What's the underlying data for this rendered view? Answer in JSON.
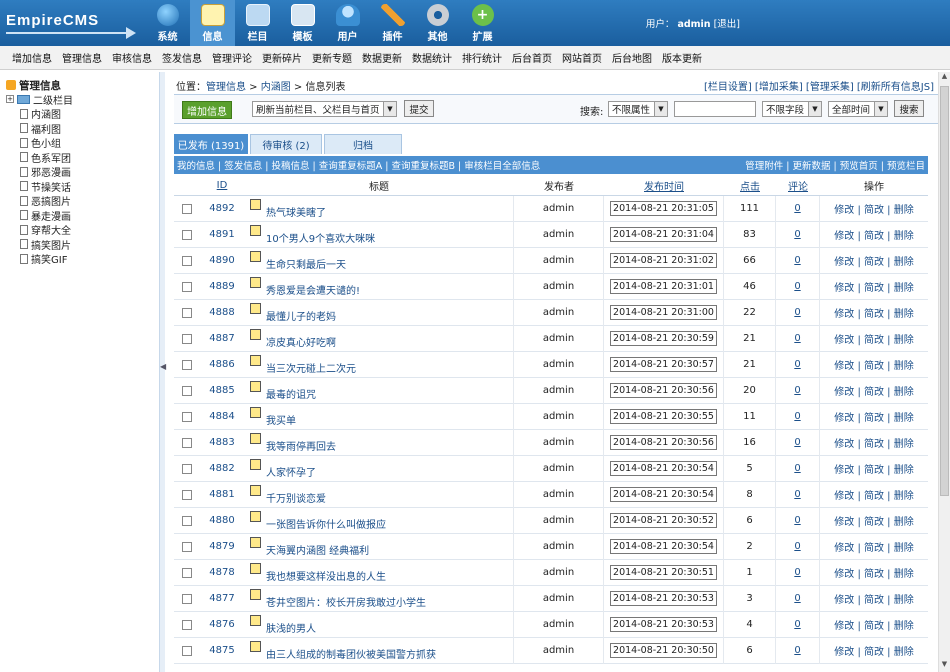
{
  "logo": "EmpireCMS",
  "topnav": [
    {
      "label": "系统",
      "icon": "globe-icon"
    },
    {
      "label": "信息",
      "icon": "document-edit-icon"
    },
    {
      "label": "栏目",
      "icon": "folder-icon"
    },
    {
      "label": "模板",
      "icon": "template-icon"
    },
    {
      "label": "用户",
      "icon": "user-icon"
    },
    {
      "label": "插件",
      "icon": "tools-icon"
    },
    {
      "label": "其他",
      "icon": "gear-icon"
    },
    {
      "label": "扩展",
      "icon": "plus-circle-icon"
    }
  ],
  "user": {
    "prefix": "用户：",
    "name": "admin",
    "logout": "[退出]"
  },
  "submenu": [
    "增加信息",
    "管理信息",
    "审核信息",
    "签发信息",
    "管理评论",
    "更新碎片",
    "更新专题",
    "数据更新",
    "数据统计",
    "排行统计",
    "后台首页",
    "网站首页",
    "后台地图",
    "版本更新"
  ],
  "sidebar": {
    "title": "管理信息",
    "parent": "二级栏目",
    "items": [
      "内涵图",
      "福利图",
      "色小组",
      "色系军团",
      "邪恶漫画",
      "节操笑话",
      "恶搞图片",
      "暴走漫画",
      "穿帮大全",
      "搞笑图片",
      "搞笑GIF"
    ]
  },
  "breadcrumb": {
    "prefix": "位置：",
    "l1": "管理信息",
    "sep": " > ",
    "l2": "内涵图",
    "l3": "信息列表"
  },
  "toplinks": "[栏目设置] [增加采集] [管理采集] [刷新所有信息JS]",
  "toolbar": {
    "add": "增加信息",
    "refresh_select": "刷新当前栏目、父栏目与首页",
    "submit": "提交",
    "search_label": "搜索:",
    "attr_select": "不限属性",
    "field_select": "不限字段",
    "time_select": "全部时间",
    "search_btn": "搜索"
  },
  "tabs": [
    "已发布 (1391)",
    "待审核 (2)",
    "归档"
  ],
  "bar": {
    "left": "我的信息 | 签发信息 | 投稿信息 | 查询重复标题A | 查询重复标题B | 审核栏目全部信息",
    "right": "管理附件 | 更新数据 | 预览首页 | 预览栏目"
  },
  "columns": {
    "id": "ID",
    "title": "标题",
    "publisher": "发布者",
    "time": "发布时间",
    "clicks": "点击",
    "comments": "评论",
    "ops": "操作"
  },
  "rows": [
    {
      "id": "4892",
      "title": "热气球美瞎了",
      "pub": "admin",
      "time": "2014-08-21 20:31:05",
      "clicks": "111",
      "cmt": "0"
    },
    {
      "id": "4891",
      "title": "10个男人9个喜欢大咪咪",
      "pub": "admin",
      "time": "2014-08-21 20:31:04",
      "clicks": "83",
      "cmt": "0"
    },
    {
      "id": "4890",
      "title": "生命只剩最后一天",
      "pub": "admin",
      "time": "2014-08-21 20:31:02",
      "clicks": "66",
      "cmt": "0"
    },
    {
      "id": "4889",
      "title": "秀恩爱是会遭天谴的!",
      "pub": "admin",
      "time": "2014-08-21 20:31:01",
      "clicks": "46",
      "cmt": "0"
    },
    {
      "id": "4888",
      "title": "最懂儿子的老妈",
      "pub": "admin",
      "time": "2014-08-21 20:31:00",
      "clicks": "22",
      "cmt": "0"
    },
    {
      "id": "4887",
      "title": "凉皮真心好吃啊",
      "pub": "admin",
      "time": "2014-08-21 20:30:59",
      "clicks": "21",
      "cmt": "0"
    },
    {
      "id": "4886",
      "title": "当三次元碰上二次元",
      "pub": "admin",
      "time": "2014-08-21 20:30:57",
      "clicks": "21",
      "cmt": "0"
    },
    {
      "id": "4885",
      "title": "最毒的诅咒",
      "pub": "admin",
      "time": "2014-08-21 20:30:56",
      "clicks": "20",
      "cmt": "0"
    },
    {
      "id": "4884",
      "title": "我买单",
      "pub": "admin",
      "time": "2014-08-21 20:30:55",
      "clicks": "11",
      "cmt": "0"
    },
    {
      "id": "4883",
      "title": "我等雨停再回去",
      "pub": "admin",
      "time": "2014-08-21 20:30:56",
      "clicks": "16",
      "cmt": "0"
    },
    {
      "id": "4882",
      "title": "人家怀孕了",
      "pub": "admin",
      "time": "2014-08-21 20:30:54",
      "clicks": "5",
      "cmt": "0"
    },
    {
      "id": "4881",
      "title": "千万别谈恋爱",
      "pub": "admin",
      "time": "2014-08-21 20:30:54",
      "clicks": "8",
      "cmt": "0"
    },
    {
      "id": "4880",
      "title": "一张图告诉你什么叫做报应",
      "pub": "admin",
      "time": "2014-08-21 20:30:52",
      "clicks": "6",
      "cmt": "0"
    },
    {
      "id": "4879",
      "title": "天海翼内涵图 经典福利",
      "pub": "admin",
      "time": "2014-08-21 20:30:54",
      "clicks": "2",
      "cmt": "0"
    },
    {
      "id": "4878",
      "title": "我也想要这样没出息的人生",
      "pub": "admin",
      "time": "2014-08-21 20:30:51",
      "clicks": "1",
      "cmt": "0"
    },
    {
      "id": "4877",
      "title": "苍井空图片：校长开房我敢过小学生",
      "pub": "admin",
      "time": "2014-08-21 20:30:53",
      "clicks": "3",
      "cmt": "0"
    },
    {
      "id": "4876",
      "title": "肤浅的男人",
      "pub": "admin",
      "time": "2014-08-21 20:30:53",
      "clicks": "4",
      "cmt": "0"
    },
    {
      "id": "4875",
      "title": "由三人组成的制毒团伙被美国警方抓获",
      "pub": "admin",
      "time": "2014-08-21 20:30:50",
      "clicks": "6",
      "cmt": "0"
    }
  ],
  "ops": "修改 | 简改 | 删除"
}
